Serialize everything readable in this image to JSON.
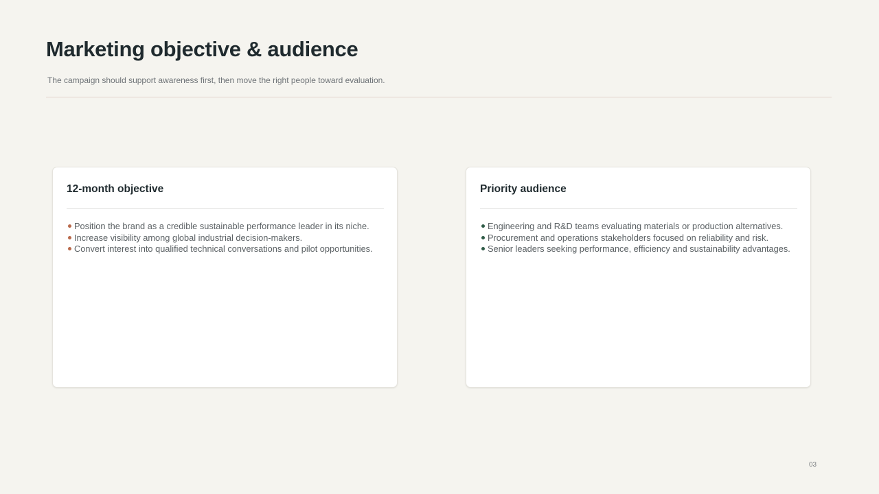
{
  "slide": {
    "title": "Marketing objective & audience",
    "subtitle": "The campaign should support awareness first, then move the right people toward evaluation.",
    "page_number": "03"
  },
  "colors": {
    "objective_bullet": "#b9694b",
    "audience_bullet": "#2f5b47",
    "background": "#f5f4ef",
    "title_text": "#1f2a2e"
  },
  "cards": {
    "objective": {
      "title": "12-month objective",
      "items": [
        "Position the brand as a credible sustainable performance leader in its niche.",
        "Increase visibility among global industrial decision-makers.",
        "Convert interest into qualified technical conversations and pilot opportunities."
      ]
    },
    "audience": {
      "title": "Priority audience",
      "items": [
        "Engineering and R&D teams evaluating materials or production alternatives.",
        "Procurement and operations stakeholders focused on reliability and risk.",
        "Senior leaders seeking performance, efficiency and sustainability advantages."
      ]
    }
  }
}
